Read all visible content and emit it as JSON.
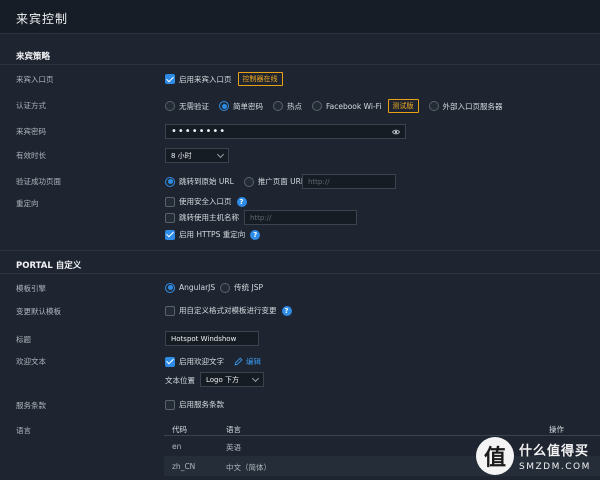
{
  "page": {
    "title": "来宾控制"
  },
  "guest_policy": {
    "section_title": "来宾策略",
    "portal": {
      "label": "来宾入口页",
      "checkbox_label": "启用来宾入口页",
      "checked": true,
      "badge": "控制器在线"
    },
    "auth": {
      "label": "认证方式",
      "options": [
        "无需验证",
        "简单密码",
        "热点",
        "Facebook Wi-Fi",
        "外部入口页服务器"
      ],
      "selected": "简单密码",
      "facebook_badge": "测试版"
    },
    "password": {
      "label": "来宾密码",
      "value": "••••••••"
    },
    "expiry": {
      "label": "有效时长",
      "value": "8 小时"
    },
    "success_page": {
      "label": "验证成功页面",
      "option1": "跳转到原始 URL",
      "option2": "推广页面 URL",
      "selected": "跳转到原始 URL",
      "url_placeholder": "http://"
    },
    "redirect": {
      "label": "重定向",
      "secure_portal": {
        "label": "使用安全入口页",
        "checked": false
      },
      "hostname": {
        "label": "跳转使用主机名称",
        "checked": false,
        "placeholder": "http://"
      },
      "https": {
        "label": "启用 HTTPS 重定向",
        "checked": true
      }
    }
  },
  "portal_custom": {
    "section_title": "PORTAL 自定义",
    "template_engine": {
      "label": "模板引擎",
      "options": [
        "AngularJS",
        "传统 JSP"
      ],
      "selected": "AngularJS"
    },
    "default_template": {
      "label": "变更默认模板",
      "checkbox_label": "用自定义格式对模板进行变更",
      "checked": false
    },
    "title": {
      "label": "标题",
      "value": "Hotspot Windshow"
    },
    "welcome": {
      "label": "欢迎文本",
      "checkbox_label": "启用欢迎文字",
      "checked": true,
      "edit_label": "编辑",
      "position_label": "文本位置",
      "position_value": "Logo 下方"
    },
    "tos": {
      "label": "服务条款",
      "checkbox_label": "启用服务条款",
      "checked": false
    },
    "language": {
      "label": "语言",
      "columns": [
        "代码",
        "语言",
        "操作"
      ],
      "rows": [
        {
          "code": "en",
          "name": "英语"
        },
        {
          "code": "zh_CN",
          "name": "中文（简体）"
        }
      ]
    }
  },
  "watermark": {
    "logo_char": "值",
    "main": "什么值得买",
    "sub": "SMZDM.COM"
  },
  "colors": {
    "accent": "#2e8be6",
    "badge": "#f0a820",
    "background": "#1e2530"
  }
}
